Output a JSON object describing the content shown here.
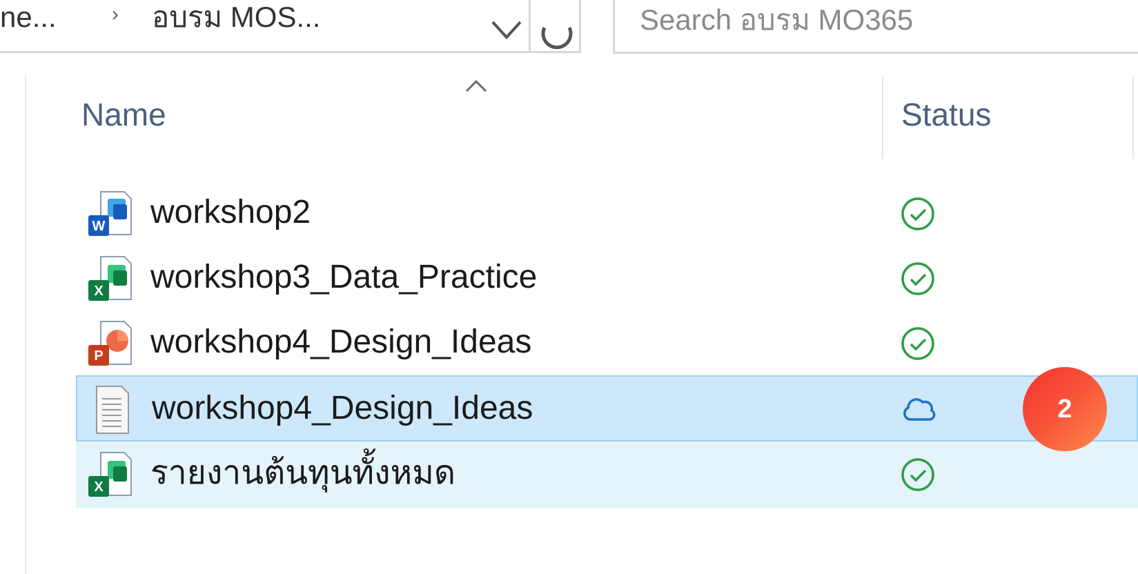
{
  "addressbar": {
    "crumbs": [
      "ne...",
      "อบรม MOS..."
    ],
    "separator": "›"
  },
  "search": {
    "placeholder": "Search อบรม MO365"
  },
  "columns": {
    "name": "Name",
    "status": "Status"
  },
  "files": [
    {
      "name": "workshop2",
      "type": "word-icon",
      "status": "synced-check-icon"
    },
    {
      "name": "workshop3_Data_Practice",
      "type": "excel-icon",
      "status": "synced-check-icon"
    },
    {
      "name": "workshop4_Design_Ideas",
      "type": "powerpoint-icon",
      "status": "synced-check-icon"
    },
    {
      "name": "workshop4_Design_Ideas",
      "type": "text-document-icon",
      "status": "cloud-only-icon",
      "state": "selected"
    },
    {
      "name": "รายงานต้นทุนทั้งหมด",
      "type": "excel-icon",
      "status": "synced-check-icon",
      "state": "hover"
    }
  ],
  "step_badge": "2",
  "colors": {
    "selected_bg": "#cce8fa",
    "hover_bg": "#e5f3fb",
    "synced_green": "#2e9e46",
    "cloud_blue": "#1a73c8",
    "badge_start": "#f4342f",
    "badge_end": "#ff8b4c"
  }
}
